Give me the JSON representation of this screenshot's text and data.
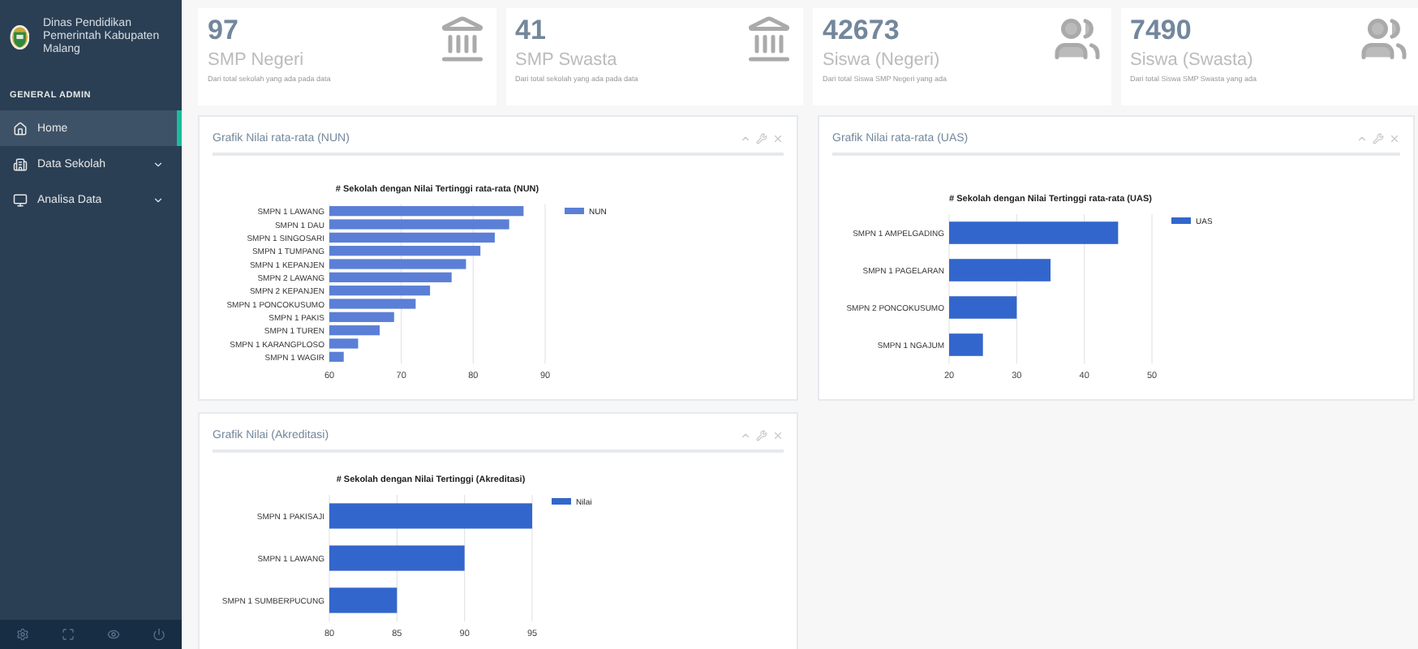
{
  "sidebar": {
    "brand": "Dinas Pendidikan Pemerintah Kabupaten Malang",
    "section_title": "GENERAL ADMIN",
    "items": [
      {
        "label": "Home",
        "kind": "link",
        "selected": true
      },
      {
        "label": "Data Sekolah",
        "kind": "menu",
        "selected": false
      },
      {
        "label": "Analisa Data",
        "kind": "menu",
        "selected": false
      }
    ]
  },
  "stats": [
    {
      "value": "97",
      "label": "SMP Negeri",
      "description": "Dari total sekolah yang ada pada data",
      "kind": "school"
    },
    {
      "value": "41",
      "label": "SMP Swasta",
      "description": "Dari total sekolah yang ada pada data",
      "kind": "school"
    },
    {
      "value": "42673",
      "label": "Siswa (Negeri)",
      "description": "Dari total Siswa SMP Negeri yang ada",
      "kind": "students"
    },
    {
      "value": "7490",
      "label": "Siswa (Swasta)",
      "description": "Dari total Siswa SMP Swasta yang ada",
      "kind": "students"
    }
  ],
  "panels": [
    {
      "title": "Grafik Nilai rata-rata (NUN)",
      "chart_data": {
        "type": "bar",
        "orientation": "horizontal",
        "title": "# Sekolah dengan Nilai Tertinggi rata-rata (NUN)",
        "categories": [
          "SMPN 1 LAWANG",
          "SMPN 1 DAU",
          "SMPN 1 SINGOSARI",
          "SMPN 1 TUMPANG",
          "SMPN 1 KEPANJEN",
          "SMPN 2 LAWANG",
          "SMPN 2 KEPANJEN",
          "SMPN 1 PONCOKUSUMO",
          "SMPN 1 PAKIS",
          "SMPN 1 TUREN",
          "SMPN 1 KARANGPLOSO",
          "SMPN 1 WAGIR"
        ],
        "series": [
          {
            "name": "NUN",
            "color": "#5b7fd6",
            "values": [
              87,
              85,
              83,
              81,
              79,
              77,
              74,
              72,
              69,
              67,
              64,
              62
            ]
          }
        ],
        "xlim": [
          60,
          90
        ],
        "xticks": [
          60,
          70,
          80,
          90
        ]
      }
    },
    {
      "title": "Grafik Nilai rata-rata (UAS)",
      "chart_data": {
        "type": "bar",
        "orientation": "horizontal",
        "title": "# Sekolah dengan Nilai Tertinggi rata-rata (UAS)",
        "categories": [
          "SMPN 1 AMPELGADING",
          "SMPN 1 PAGELARAN",
          "SMPN 2 PONCOKUSUMO",
          "SMPN 1 NGAJUM"
        ],
        "series": [
          {
            "name": "UAS",
            "color": "#3366cc",
            "values": [
              45,
              35,
              30,
              25
            ]
          }
        ],
        "xlim": [
          20,
          50
        ],
        "xticks": [
          20,
          30,
          40,
          50
        ]
      }
    },
    {
      "title": "Grafik Nilai (Akreditasi)",
      "chart_data": {
        "type": "bar",
        "orientation": "horizontal",
        "title": "# Sekolah dengan Nilai Tertinggi (Akreditasi)",
        "categories": [
          "SMPN 1 PAKISAJI",
          "SMPN 1 LAWANG",
          "SMPN 1 SUMBERPUCUNG"
        ],
        "series": [
          {
            "name": "Nilai",
            "color": "#3366cc",
            "values": [
              95,
              90,
              85
            ]
          }
        ],
        "xlim": [
          80,
          95
        ],
        "xticks": [
          80,
          85,
          90,
          95
        ]
      }
    }
  ]
}
